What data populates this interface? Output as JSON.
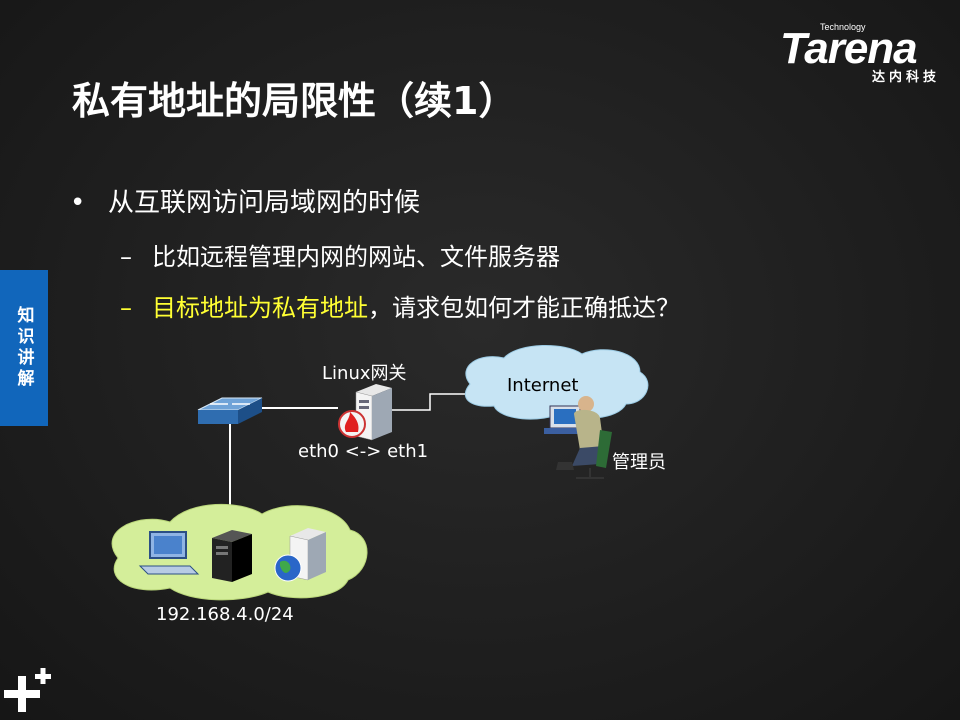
{
  "brand": {
    "technology": "Technology",
    "name": "Tarena",
    "cn": "达内科技"
  },
  "title": "私有地址的局限性（续1）",
  "bullets": {
    "l1": "从互联网访问局域网的时候",
    "l2a": "比如远程管理内网的网站、文件服务器",
    "l2b_highlight": "目标地址为私有地址",
    "l2b_rest": "，请求包如何才能正确抵达？"
  },
  "side_tab": "知识讲解",
  "diagram": {
    "gateway_label": "Linux网关",
    "gateway_ifaces": "eth0 <-> eth1",
    "internet_label": "Internet",
    "admin_label": "管理员",
    "lan_label": "192.168.4.0/24"
  },
  "colors": {
    "highlight": "#ffff33",
    "side_tab": "#1166bb",
    "cloud": "#d4ee9a",
    "internet_cloud": "#c6e4f4"
  }
}
